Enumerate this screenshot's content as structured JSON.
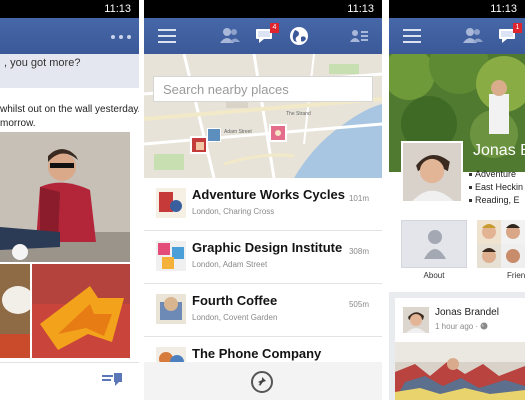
{
  "status": {
    "time": "11:13"
  },
  "feed_screen": {
    "header_text": ", you got more?",
    "post_line1": "whilst out on the wall yesterday.",
    "post_line2": "morrow."
  },
  "places_screen": {
    "search_placeholder": "Search nearby places",
    "notification_count": "4",
    "map_labels": [
      "Adam Street",
      "The Strand"
    ],
    "places": [
      {
        "name": "Adventure Works Cycles",
        "address": "London, Charing Cross",
        "distance": "101m"
      },
      {
        "name": "Graphic Design Institute",
        "address": "London, Adam Street",
        "distance": "308m"
      },
      {
        "name": "Fourth Coffee",
        "address": "London, Covent Garden",
        "distance": "505m"
      },
      {
        "name": "The Phone Company",
        "address": "",
        "distance": ""
      }
    ]
  },
  "profile_screen": {
    "name": "Jonas B",
    "info": [
      "Adventure",
      "East Heckin",
      "Reading, E"
    ],
    "tiles": {
      "about": "About",
      "friends": "Friend"
    },
    "post": {
      "author": "Jonas Brandel",
      "time": "1 hour ago",
      "separator": "·"
    },
    "notification_count": "1"
  },
  "colors": {
    "facebook_blue": "#3b5998",
    "badge_red": "#e0242e"
  }
}
